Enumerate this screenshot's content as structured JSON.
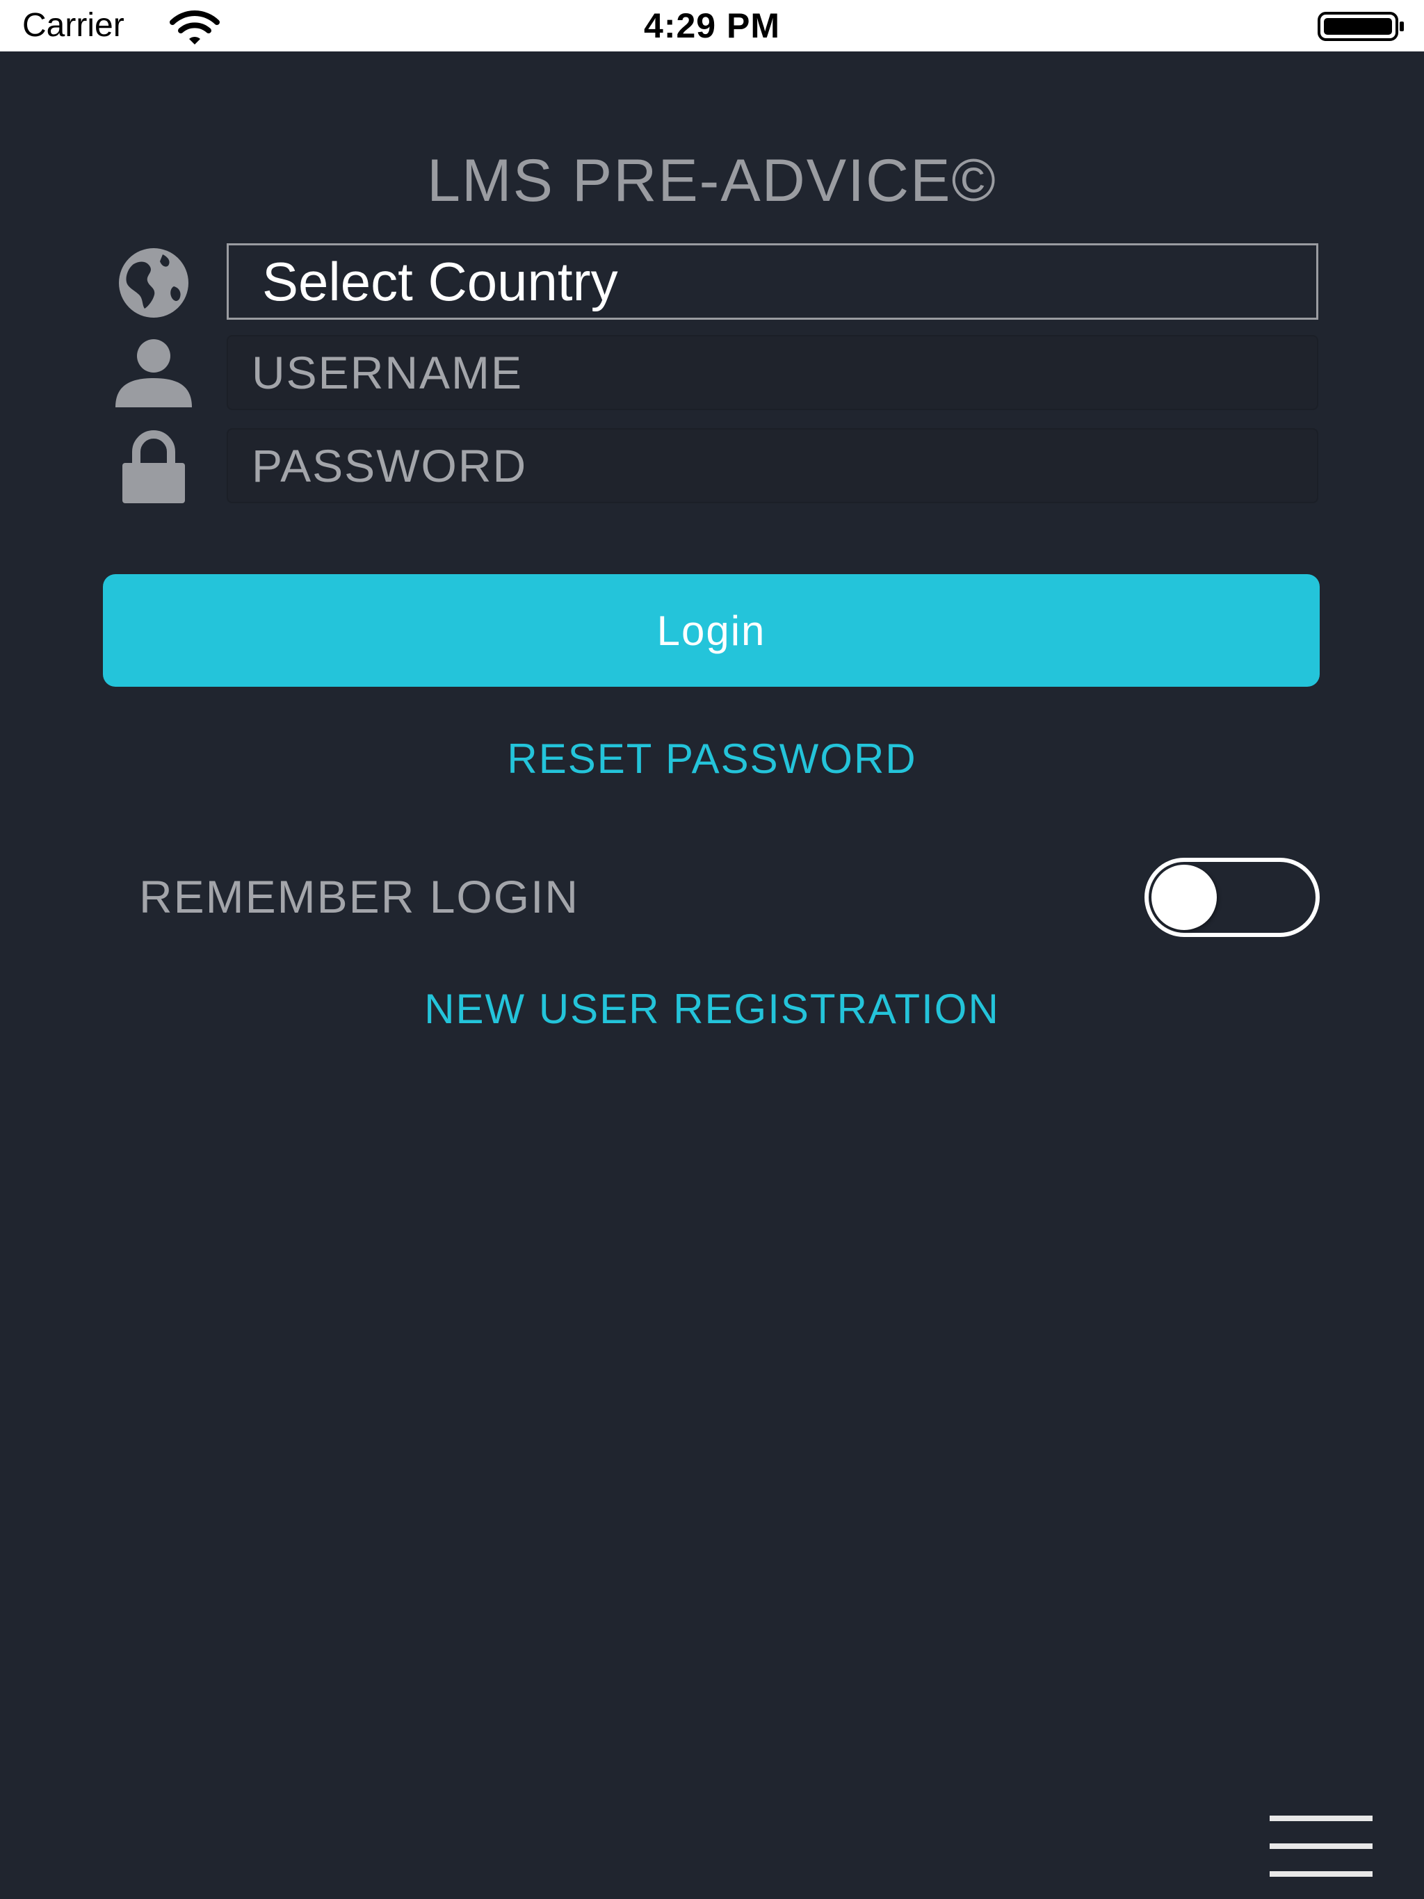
{
  "status_bar": {
    "carrier": "Carrier",
    "time": "4:29 PM",
    "icons": [
      "wifi-icon",
      "battery-icon"
    ]
  },
  "app": {
    "title": "LMS PRE-ADVICE©"
  },
  "form": {
    "country": {
      "icon": "globe-icon",
      "value": "Select Country"
    },
    "username": {
      "icon": "user-icon",
      "placeholder": "USERNAME"
    },
    "password": {
      "icon": "lock-icon",
      "placeholder": "PASSWORD"
    },
    "login_label": "Login",
    "reset_password_label": "RESET PASSWORD",
    "remember_login_label": "REMEMBER LOGIN",
    "remember_login_on": false,
    "new_user_registration_label": "NEW USER REGISTRATION"
  },
  "footer": {
    "menu_icon": "hamburger-menu-icon"
  },
  "colors": {
    "background": "#20252f",
    "accent": "#24c4da",
    "muted_text": "#a3a5aa",
    "icon_gray": "#9a9ca1"
  }
}
